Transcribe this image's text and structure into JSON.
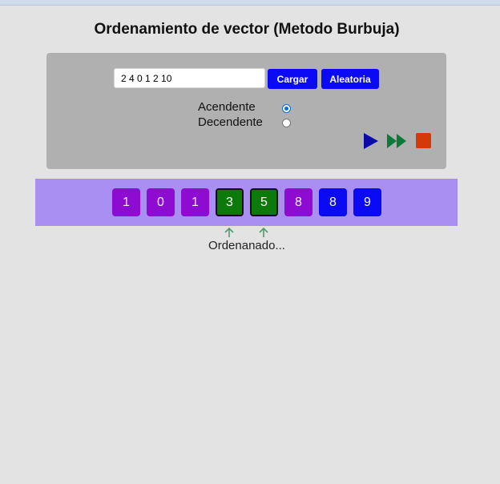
{
  "page": {
    "title": "Ordenamiento de vector (Metodo Burbuja)"
  },
  "controls": {
    "vector_input_value": "2 4 0 1 2 10",
    "load_label": "Cargar",
    "random_label": "Aleatoria",
    "order_options": [
      {
        "label": "Acendente",
        "selected": true
      },
      {
        "label": "Decendente",
        "selected": false
      }
    ],
    "icons": [
      "play-icon",
      "fast-forward-icon",
      "stop-icon"
    ],
    "colors": {
      "button": "#0a0af5",
      "play": "#0a0aa8",
      "fast_forward": "#0b7a3a",
      "stop": "#d33a0a"
    }
  },
  "vector": {
    "cells": [
      {
        "value": "1",
        "state": "purple"
      },
      {
        "value": "0",
        "state": "purple"
      },
      {
        "value": "1",
        "state": "purple"
      },
      {
        "value": "3",
        "state": "green"
      },
      {
        "value": "5",
        "state": "green"
      },
      {
        "value": "8",
        "state": "purple"
      },
      {
        "value": "8",
        "state": "blue"
      },
      {
        "value": "9",
        "state": "blue"
      }
    ],
    "colors": {
      "purple": "#8e0bd1",
      "green": "#0b7a0b",
      "blue": "#0a0af5",
      "strip": "#a98ff2"
    }
  },
  "status": {
    "text": "Ordenanado..."
  }
}
